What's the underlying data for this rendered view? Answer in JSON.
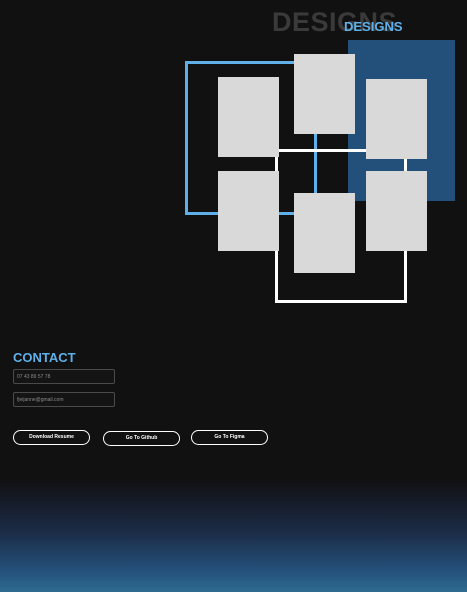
{
  "designs": {
    "title_shadow": "DESIGNS",
    "title": "DESIGNS"
  },
  "contact": {
    "title": "CONTACT",
    "phone": "07 43 89 57 78",
    "email": "fjeijanne@gmail.com",
    "buttons": {
      "resume": "Download Resume",
      "github": "Go To Github",
      "figma": "Go To Figma"
    }
  },
  "colors": {
    "background": "#121112",
    "accent": "#5fb0e8",
    "accent_dark": "#23507a",
    "card": "#d9d9d9"
  }
}
